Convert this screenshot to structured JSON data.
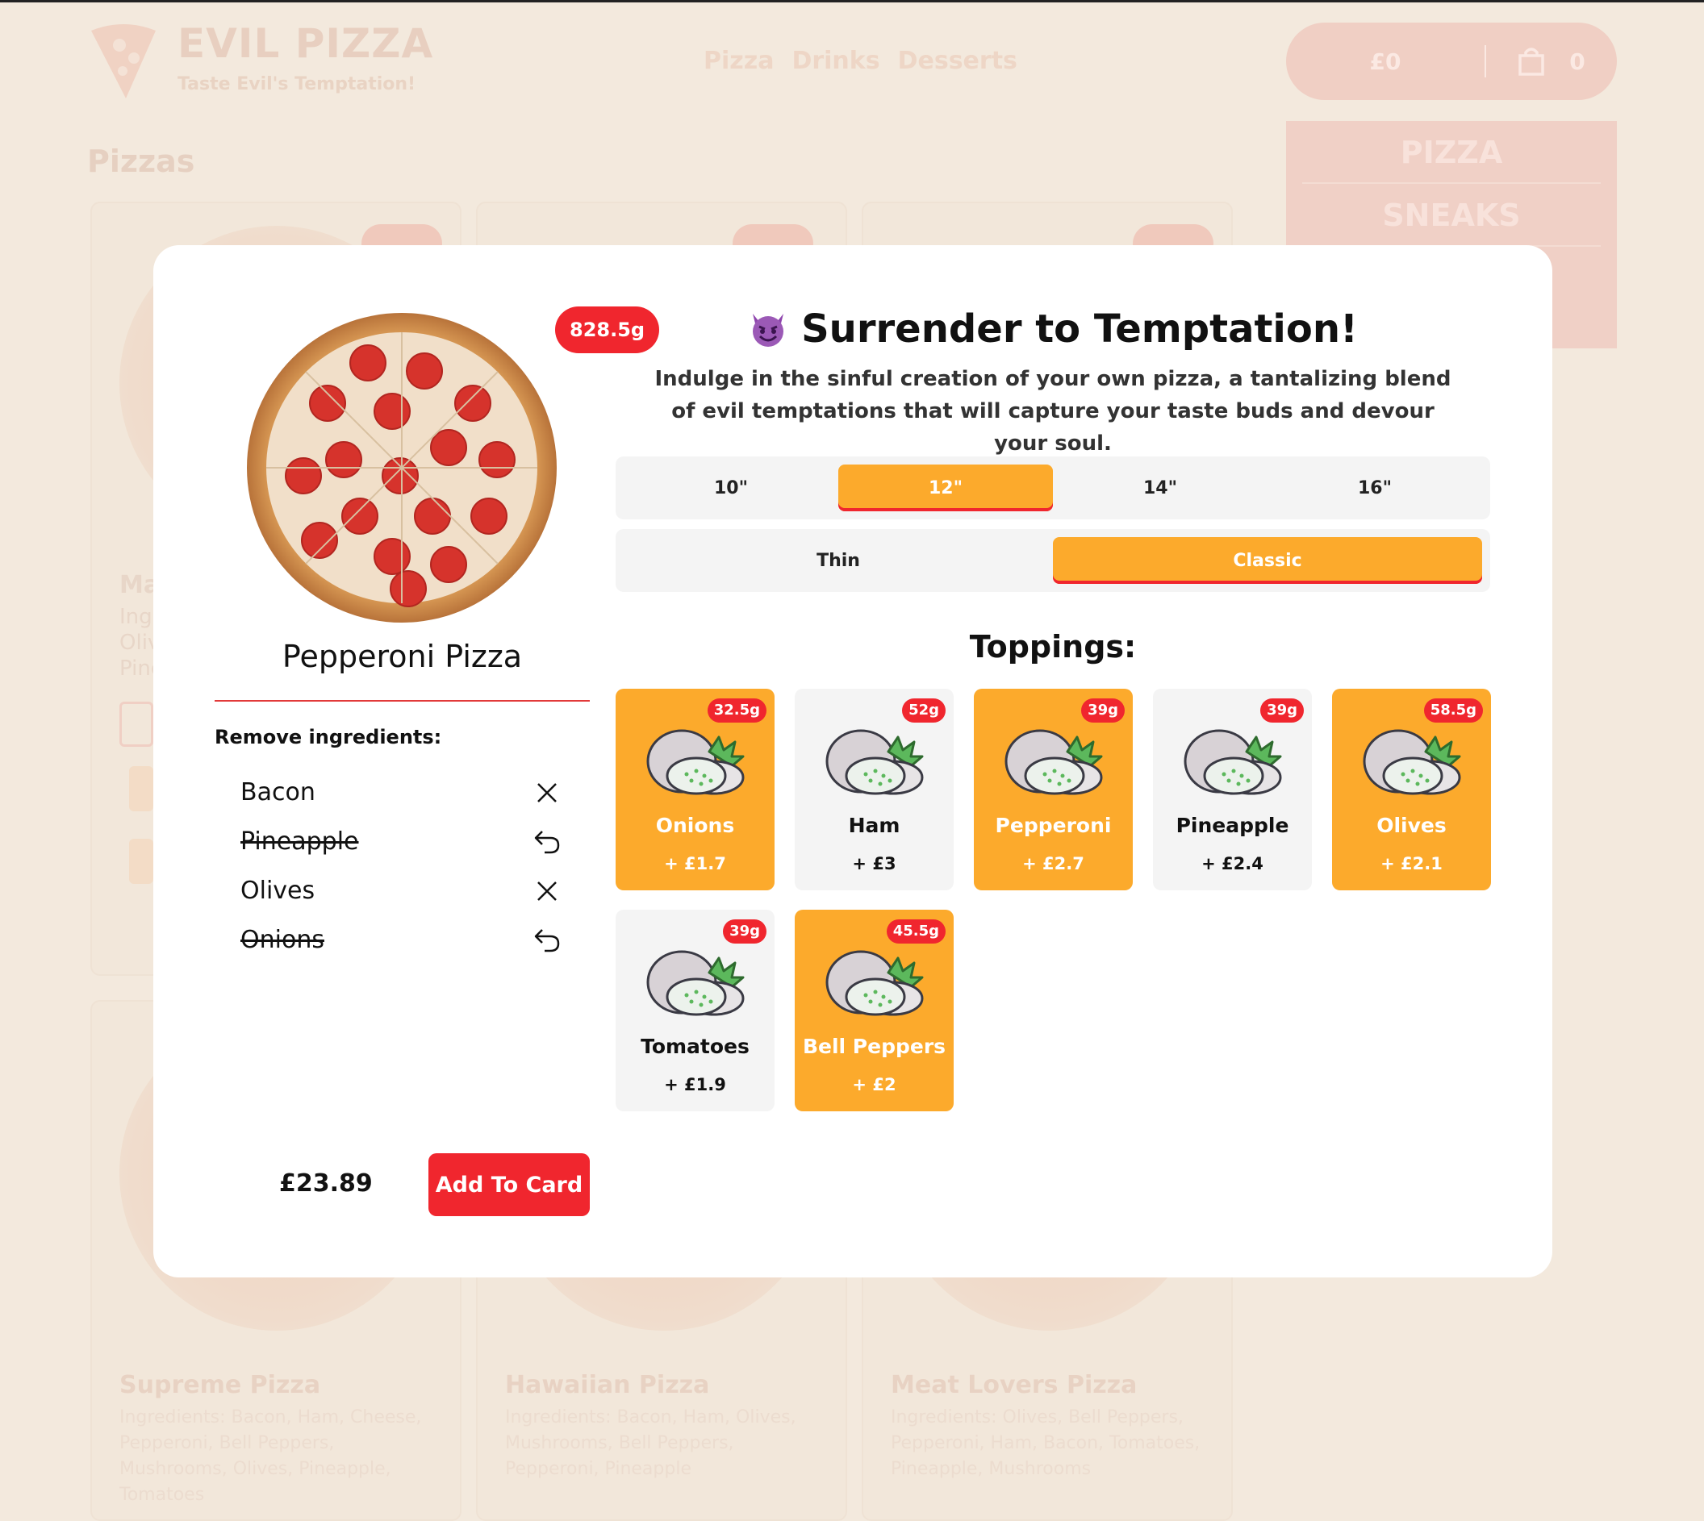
{
  "header": {
    "brand_name": "EVIL PIZZA",
    "tagline": "Taste Evil's Temptation!",
    "nav": [
      "Pizza",
      "Drinks",
      "Desserts"
    ],
    "cart_total": "£0",
    "cart_count": "0"
  },
  "promo": [
    "PIZZA",
    "SNEAKS"
  ],
  "catalog": {
    "heading": "Pizzas",
    "left_fragments": [
      "Ma",
      "Ing",
      "Oliv",
      "Pine"
    ],
    "cards": [
      {
        "name": "Supreme Pizza",
        "ingredients": "Ingredients: Bacon, Ham, Cheese, Pepperoni, Bell Peppers, Mushrooms, Olives, Pineapple, Tomatoes"
      },
      {
        "name": "Hawaiian Pizza",
        "ingredients": "Ingredients: Bacon, Ham, Olives, Mushrooms, Bell Peppers, Pepperoni, Pineapple"
      },
      {
        "name": "Meat Lovers Pizza",
        "ingredients": "Ingredients: Olives, Bell Peppers, Pepperoni, Ham, Bacon, Tomatoes, Pineapple, Mushrooms"
      }
    ]
  },
  "modal": {
    "title": "Surrender to Temptation!",
    "title_icon": "devil-emoji-icon",
    "description": "Indulge in the sinful creation of your own pizza, a tantalizing blend of evil temptations that will capture your taste buds and devour your soul.",
    "pizza": {
      "name": "Pepperoni Pizza",
      "weight": "828.5g",
      "image": "pepperoni-pizza-image"
    },
    "remove_title": "Remove ingredients:",
    "ingredients": [
      {
        "name": "Bacon",
        "removed": false,
        "icon": "close-icon"
      },
      {
        "name": "Pineapple",
        "removed": true,
        "icon": "undo-icon"
      },
      {
        "name": "Olives",
        "removed": false,
        "icon": "close-icon"
      },
      {
        "name": "Onions",
        "removed": true,
        "icon": "undo-icon"
      }
    ],
    "sizes": [
      {
        "label": "10\"",
        "active": false
      },
      {
        "label": "12\"",
        "active": true
      },
      {
        "label": "14\"",
        "active": false
      },
      {
        "label": "16\"",
        "active": false
      }
    ],
    "crusts": [
      {
        "label": "Thin",
        "active": false
      },
      {
        "label": "Classic",
        "active": true
      }
    ],
    "toppings_title": "Toppings:",
    "toppings": [
      {
        "name": "Onions",
        "price": "+ £1.7",
        "weight": "32.5g",
        "selected": true
      },
      {
        "name": "Ham",
        "price": "+ £3",
        "weight": "52g",
        "selected": false
      },
      {
        "name": "Pepperoni",
        "price": "+ £2.7",
        "weight": "39g",
        "selected": true
      },
      {
        "name": "Pineapple",
        "price": "+ £2.4",
        "weight": "39g",
        "selected": false
      },
      {
        "name": "Olives",
        "price": "+ £2.1",
        "weight": "58.5g",
        "selected": true
      },
      {
        "name": "Tomatoes",
        "price": "+ £1.9",
        "weight": "39g",
        "selected": false
      },
      {
        "name": "Bell Peppers",
        "price": "+ £2",
        "weight": "45.5g",
        "selected": true
      }
    ],
    "total_price": "£23.89",
    "add_button": "Add To Card"
  },
  "colors": {
    "accent": "#fcaa2c",
    "brand_red": "#f0262e",
    "backdrop": "#f3e9dd"
  }
}
